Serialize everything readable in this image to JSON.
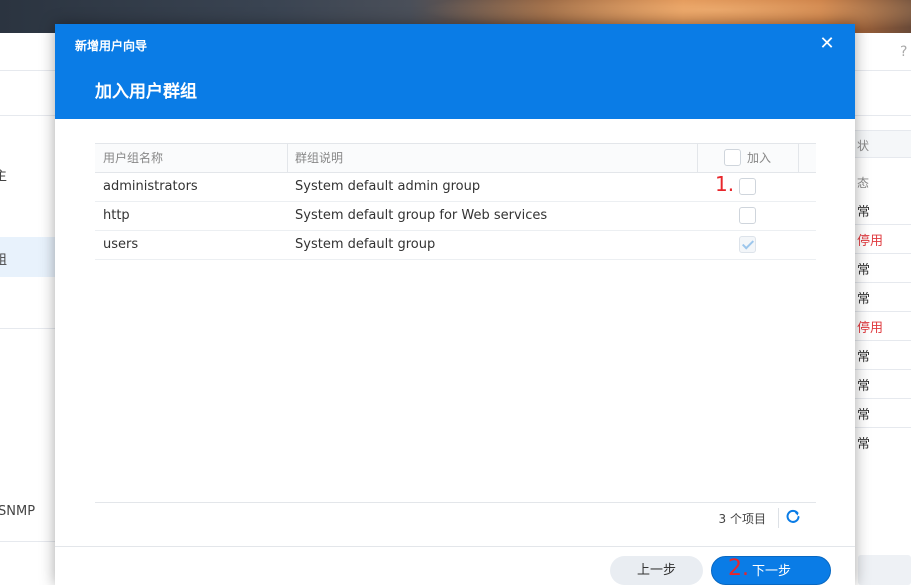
{
  "background": {
    "left_items": [
      "主",
      "组",
      "SNMP"
    ],
    "right_header": "状",
    "right_column_title": "态",
    "statuses": [
      {
        "text": "常",
        "kind": "normal"
      },
      {
        "text": "停用",
        "kind": "disabled"
      },
      {
        "text": "常",
        "kind": "normal"
      },
      {
        "text": "常",
        "kind": "normal"
      },
      {
        "text": "停用",
        "kind": "disabled"
      },
      {
        "text": "常",
        "kind": "normal"
      },
      {
        "text": "常",
        "kind": "normal"
      },
      {
        "text": "常",
        "kind": "normal"
      },
      {
        "text": "常",
        "kind": "normal"
      }
    ],
    "help": "?"
  },
  "dialog": {
    "wizard_title": "新增用户向导",
    "close_label": "✕",
    "step_title": "加入用户群组",
    "grid": {
      "columns": {
        "name": "用户组名称",
        "description": "群组说明",
        "join": "加入"
      },
      "rows": [
        {
          "name": "administrators",
          "description": "System default admin group",
          "joined": false
        },
        {
          "name": "http",
          "description": "System default group for Web services",
          "joined": false
        },
        {
          "name": "users",
          "description": "System default group",
          "joined": true
        }
      ]
    },
    "annotations": {
      "step1": "1.",
      "step2": "2."
    },
    "item_count": "3 个项目",
    "buttons": {
      "prev": "上一步",
      "next": "下一步"
    }
  },
  "colors": {
    "header_blue": "#0a7ce6",
    "annotation_red": "#e8262b",
    "disabled_red": "#e0393e"
  },
  "icons": {
    "close": "close-icon",
    "refresh": "refresh-icon",
    "check": "check-icon"
  }
}
